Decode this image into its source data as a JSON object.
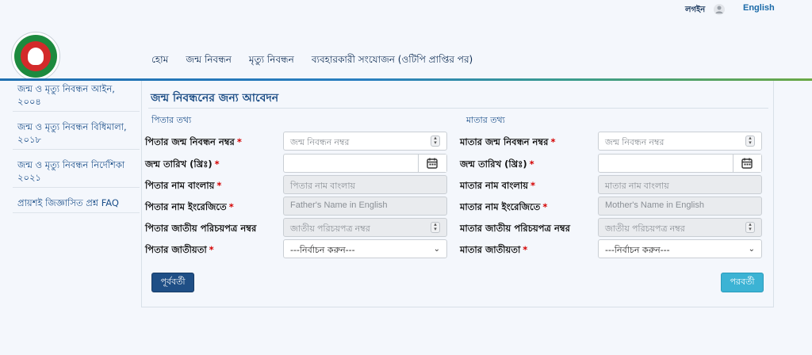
{
  "header": {
    "login": "লগইন",
    "language": "English",
    "nav": [
      "হোম",
      "জন্ম নিবন্ধন",
      "মৃত্যু নিবন্ধন",
      "ব্যবহারকারী সংযোজন (ওটিপি প্রাপ্তির পর)"
    ]
  },
  "sidebar": {
    "items": [
      "জন্ম ও মৃত্যু নিবন্ধন আইন, ২০০৪",
      "জন্ম ও মৃত্যু নিবন্ধন বিধিমালা, ২০১৮",
      "জন্ম ও মৃত্যু নিবন্ধন নির্দেশিকা ২০২১",
      "প্রায়শই জিজ্ঞাসিত প্রশ্ন FAQ"
    ]
  },
  "form": {
    "title": "জন্ম নিবন্ধনের জন্য আবেদন",
    "father_section": "পিতার তথ্য",
    "mother_section": "মাতার তথ্য",
    "required_mark": "*",
    "father": {
      "brn_label": "পিতার জন্ম নিবন্ধন নম্বর",
      "brn_placeholder": "জন্ম নিবন্ধন নম্বর",
      "dob_label": "জন্ম তারিখ (খ্রিঃ)",
      "dob_value": "",
      "name_bn_label": "পিতার নাম বাংলায়",
      "name_bn_placeholder": "পিতার নাম বাংলায়",
      "name_en_label": "পিতার নাম ইংরেজিতে",
      "name_en_placeholder": "Father's Name in English",
      "nid_label": "পিতার জাতীয় পরিচয়পত্র নম্বর",
      "nid_placeholder": "জাতীয় পরিচয়পত্র নম্বর",
      "nationality_label": "পিতার জাতীয়তা",
      "nationality_value": "---নির্বাচন করুন---"
    },
    "mother": {
      "brn_label": "মাতার জন্ম নিবন্ধন নম্বর",
      "brn_placeholder": "জন্ম নিবন্ধন নম্বর",
      "dob_label": "জন্ম তারিখ (খ্রিঃ)",
      "dob_value": "",
      "name_bn_label": "মাতার নাম বাংলায়",
      "name_bn_placeholder": "মাতার নাম বাংলায়",
      "name_en_label": "মাতার নাম ইংরেজিতে",
      "name_en_placeholder": "Mother's Name in English",
      "nid_label": "মাতার জাতীয় পরিচয়পত্র নম্বর",
      "nid_placeholder": "জাতীয় পরিচয়পত্র নম্বর",
      "nationality_label": "মাতার জাতীয়তা",
      "nationality_value": "---নির্বাচন করুন---"
    },
    "prev_button": "পূর্ববর্তী",
    "next_button": "পরবর্তী"
  },
  "colors": {
    "primary": "#1f4f86",
    "next_button": "#3cb3d4",
    "required": "#d40000",
    "link": "#1b4f8a"
  },
  "icons": [
    "user-icon",
    "logo-emblem",
    "calendar-icon",
    "spinner-icon",
    "chevron-down-icon"
  ]
}
